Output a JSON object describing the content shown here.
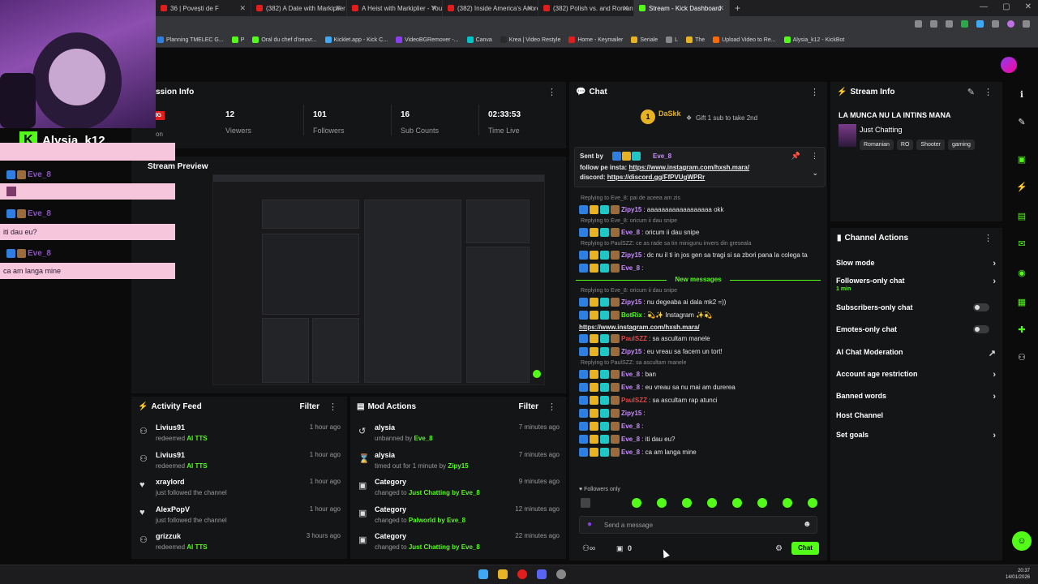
{
  "browser": {
    "tabs": [
      {
        "label": "36 | Povești de F"
      },
      {
        "label": "(382) A Date with Markiplier - Y"
      },
      {
        "label": "A Heist with Markiplier - YouTu"
      },
      {
        "label": "(382) Inside America's Anorexi"
      },
      {
        "label": "(382) Polish vs. and Romanian"
      },
      {
        "label": "Stream - Kick Dashboard"
      }
    ],
    "new_tab": "+",
    "bookmarks": [
      {
        "label": "Planning TMELEC G...",
        "color": "#2f7fe0"
      },
      {
        "label": "P",
        "color": "#53fc18"
      },
      {
        "label": "Oral du chef d'oeuvr...",
        "color": "#53fc18"
      },
      {
        "label": "Kicklet.app - Kick C...",
        "color": "#3fa9f5"
      },
      {
        "label": "VideoBGRemover -...",
        "color": "#8b3ff1"
      },
      {
        "label": "Canva",
        "color": "#00c4cc"
      },
      {
        "label": "Krea | Video Restyle",
        "color": "#2a2a2a"
      },
      {
        "label": "Home - Keymailer",
        "color": "#e21d1d"
      },
      {
        "label": "Seriale",
        "color": "#e7b325"
      },
      {
        "label": "L",
        "color": "#888"
      },
      {
        "label": "The",
        "color": "#e7b325"
      },
      {
        "label": "Upload Video to Re...",
        "color": "#ff6a00"
      },
      {
        "label": "Alysia_k12 - KickBot",
        "color": "#53fc18"
      }
    ]
  },
  "session": {
    "title": "ssion Info",
    "live_label": "REAMING",
    "live_sub": "on",
    "stats": [
      {
        "value": "12",
        "label": "Viewers"
      },
      {
        "value": "101",
        "label": "Followers"
      },
      {
        "value": "16",
        "label": "Sub Counts"
      },
      {
        "value": "02:33:53",
        "label": "Time Live"
      }
    ]
  },
  "preview": {
    "title": "Stream Preview"
  },
  "activity": {
    "title": "Activity Feed",
    "filter": "Filter",
    "items": [
      {
        "who": "Livius91",
        "pre": "redeemed",
        "what": "AI TTS",
        "when": "1 hour ago",
        "icon": "redeem-icon"
      },
      {
        "who": "Livius91",
        "pre": "redeemed",
        "what": "AI TTS",
        "when": "1 hour ago",
        "icon": "redeem-icon"
      },
      {
        "who": "xraylord",
        "pre": "just followed the channel",
        "what": "",
        "when": "1 hour ago",
        "icon": "heart-icon"
      },
      {
        "who": "AlexPopV",
        "pre": "just followed the channel",
        "what": "",
        "when": "1 hour ago",
        "icon": "heart-icon"
      },
      {
        "who": "grizzuk",
        "pre": "redeemed",
        "what": "AI TTS",
        "when": "3 hours ago",
        "icon": "redeem-icon"
      }
    ]
  },
  "mod_actions": {
    "title": "Mod Actions",
    "filter": "Filter",
    "items": [
      {
        "who": "alysia",
        "pre": "unbanned by",
        "what": "Eve_8",
        "when": "7 minutes ago",
        "icon": "unban-icon"
      },
      {
        "who": "alysia",
        "pre": "timed out for 1 minute by",
        "what": "Zipy15",
        "when": "7 minutes ago",
        "icon": "hourglass-icon"
      },
      {
        "who": "Category",
        "pre": "changed to",
        "what": "Just Chatting by Eve_8",
        "when": "9 minutes ago",
        "icon": "category-icon"
      },
      {
        "who": "Category",
        "pre": "changed to",
        "what": "Palworld by Eve_8",
        "when": "12 minutes ago",
        "icon": "category-icon"
      },
      {
        "who": "Category",
        "pre": "changed to",
        "what": "Just Chatting by Eve_8",
        "when": "22 minutes ago",
        "icon": "category-icon"
      }
    ]
  },
  "chat": {
    "title": "Chat",
    "gifter_name": "DaSkk",
    "gifter_count": "1",
    "gift_text": "Gift 1 sub to take 2nd",
    "pinned_by": "Sent by",
    "pinned_user": "Eve_8",
    "pinned_line1": "follow pe insta:",
    "pinned_link1": "https://www.instagram.com/hxsh.mara/",
    "pinned_line2": "discord:",
    "pinned_link2": "https://discord.gg/FfPVUgWPRr",
    "messages": [
      {
        "type": "reply",
        "text": "Replying to Eve_8: pai de aceea am zis"
      },
      {
        "type": "msg",
        "user": "Zipy15",
        "ucolor": "#c88cff",
        "text": ": aaaaaaaaaaaaaaaaaa okk"
      },
      {
        "type": "reply",
        "text": "Replying to Eve_8: oricum ii dau snipe"
      },
      {
        "type": "msg",
        "user": "Eve_8",
        "ucolor": "#c88cff",
        "text": ": oricum ii dau snipe"
      },
      {
        "type": "reply",
        "text": "Replying to PaulSZZ: ce as rade sa tin minigunu invers din greseala"
      },
      {
        "type": "msg",
        "user": "Zipy15",
        "ucolor": "#c88cff",
        "text": ": dc nu il ti in jos gen sa tragi si sa zbori pana la colega ta"
      },
      {
        "type": "msg",
        "user": "Eve_8",
        "ucolor": "#c88cff",
        "text": ":"
      },
      {
        "type": "reply",
        "text": "Replying to Eve_8: oricum ii dau snipe"
      },
      {
        "type": "msg",
        "user": "Zipy15",
        "ucolor": "#c88cff",
        "text": ": nu degeaba ai dala mk2 =))"
      },
      {
        "type": "msg",
        "user": "BotRix",
        "ucolor": "#53fc18",
        "text": ": 💫✨ Instagram ✨💫"
      },
      {
        "type": "link",
        "text": "https://www.instagram.com/hxsh.mara/"
      },
      {
        "type": "msg",
        "user": "PaulSZZ",
        "ucolor": "#e04848",
        "text": ": sa ascultam manele"
      },
      {
        "type": "msg",
        "user": "Zipy15",
        "ucolor": "#c88cff",
        "text": ": eu vreau sa facem un tort!"
      },
      {
        "type": "reply",
        "text": "Replying to PaulSZZ: sa ascultam manele"
      },
      {
        "type": "msg",
        "user": "Eve_8",
        "ucolor": "#c88cff",
        "text": ": ban"
      },
      {
        "type": "msg",
        "user": "Eve_8",
        "ucolor": "#c88cff",
        "text": ": eu vreau sa nu mai am durerea"
      },
      {
        "type": "msg",
        "user": "PaulSZZ",
        "ucolor": "#e04848",
        "text": ": sa ascultam rap atunci"
      },
      {
        "type": "msg",
        "user": "Zipy15",
        "ucolor": "#c88cff",
        "text": ":"
      },
      {
        "type": "msg",
        "user": "Eve_8",
        "ucolor": "#c88cff",
        "text": ":"
      },
      {
        "type": "msg",
        "user": "Eve_8",
        "ucolor": "#c88cff",
        "text": ": iti dau eu?"
      },
      {
        "type": "msg",
        "user": "Eve_8",
        "ucolor": "#c88cff",
        "text": ": ca am langa mine"
      }
    ],
    "new_messages": "New messages",
    "followers_only": "Followers only",
    "input_placeholder": "Send a message",
    "points": "0",
    "send_label": "Chat"
  },
  "stream_info": {
    "title": "Stream Info",
    "stream_title": "LA MUNCA NU LA INTINS MANA",
    "category": "Just Chatting",
    "tags": [
      "Romanian",
      "RO",
      "Shooter",
      "gaming"
    ]
  },
  "channel_actions": {
    "title": "Channel Actions",
    "rows": [
      {
        "label": "Slow mode",
        "sub": "",
        "control": "chevron"
      },
      {
        "label": "Followers-only chat",
        "sub": "1 min",
        "control": "chevron"
      },
      {
        "label": "Subscribers-only chat",
        "sub": "",
        "control": "toggle"
      },
      {
        "label": "Emotes-only chat",
        "sub": "",
        "control": "toggle"
      },
      {
        "label": "AI Chat Moderation",
        "sub": "",
        "control": "external"
      },
      {
        "label": "Account age restriction",
        "sub": "",
        "control": "chevron"
      },
      {
        "label": "Banned words",
        "sub": "",
        "control": "chevron"
      },
      {
        "label": "Host Channel",
        "sub": "",
        "control": "none"
      },
      {
        "label": "Set goals",
        "sub": "",
        "control": "chevron"
      }
    ]
  },
  "overlay": {
    "streamer_name": "Alysia_k12",
    "messages": [
      {
        "user": "Eve_8",
        "text": ""
      },
      {
        "user": "Eve_8",
        "text": "iti dau eu?"
      },
      {
        "user": "Eve_8",
        "text": "ca am langa mine"
      }
    ]
  },
  "taskbar": {
    "time": "20:37",
    "date": "14/01/2026"
  },
  "colors": {
    "accent": "#53fc18",
    "live": "#e21d1d",
    "panel": "#141516"
  }
}
